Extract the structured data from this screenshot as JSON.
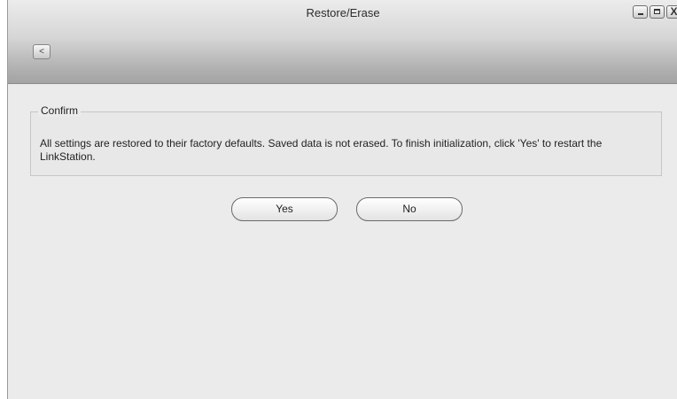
{
  "window": {
    "title": "Restore/Erase",
    "controls": {
      "minimize": "minimize-icon",
      "maximize": "maximize-icon",
      "close": "close-icon"
    },
    "close_glyph": "X",
    "back_glyph": "<"
  },
  "confirm": {
    "legend": "Confirm",
    "message": "All settings are restored to their factory defaults. Saved data is not erased. To finish initialization, click 'Yes' to restart the LinkStation."
  },
  "buttons": {
    "yes": "Yes",
    "no": "No"
  }
}
